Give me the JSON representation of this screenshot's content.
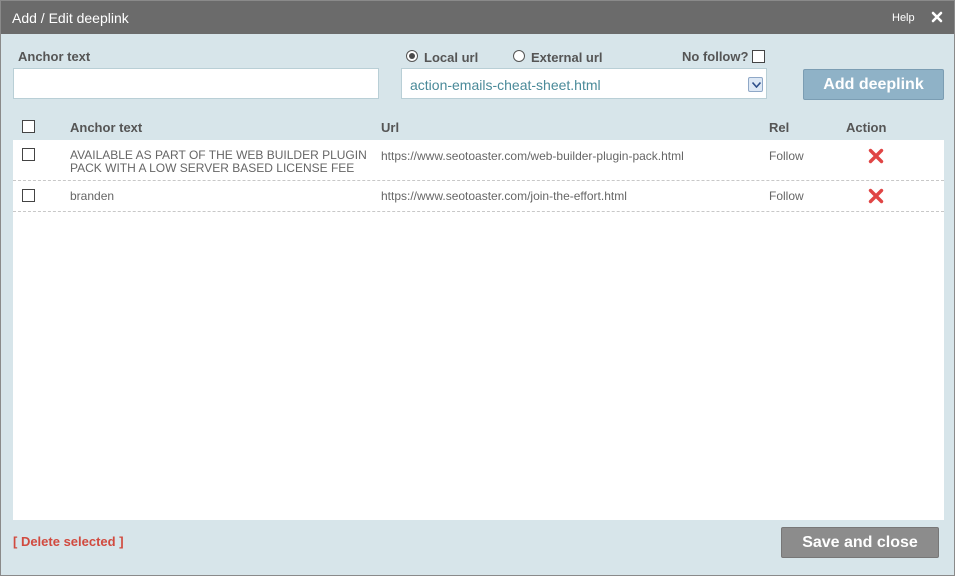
{
  "window": {
    "title": "Add / Edit deeplink",
    "help_label": "Help",
    "close_icon": "close-icon"
  },
  "form": {
    "anchor_label": "Anchor text",
    "anchor_value": "",
    "local_url_label": "Local url",
    "local_url_checked": true,
    "external_url_label": "External url",
    "external_url_checked": false,
    "nofollow_label": "No follow?",
    "nofollow_checked": false,
    "url_select_value": "action-emails-cheat-sheet.html",
    "add_button_label": "Add deeplink"
  },
  "table": {
    "headers": {
      "anchor": "Anchor text",
      "url": "Url",
      "rel": "Rel",
      "action": "Action"
    },
    "rows": [
      {
        "anchor_line1": "AVAILABLE AS PART OF THE WEB BUILDER PLUGIN",
        "anchor_line2": "PACK WITH A LOW SERVER BASED LICENSE FEE",
        "url": "https://www.seotoaster.com/web-builder-plugin-pack.html",
        "rel": "Follow"
      },
      {
        "anchor_line1": "branden",
        "anchor_line2": "",
        "url": "https://www.seotoaster.com/join-the-effort.html",
        "rel": "Follow"
      }
    ]
  },
  "footer": {
    "delete_selected_label": "[ Delete selected ]",
    "save_button_label": "Save and close"
  },
  "colors": {
    "titlebar": "#6b6b6b",
    "panel_bg": "#d7e5ea",
    "accent_button": "#8fb2c7",
    "delete_red": "#e04545",
    "select_text": "#4a8a99"
  }
}
